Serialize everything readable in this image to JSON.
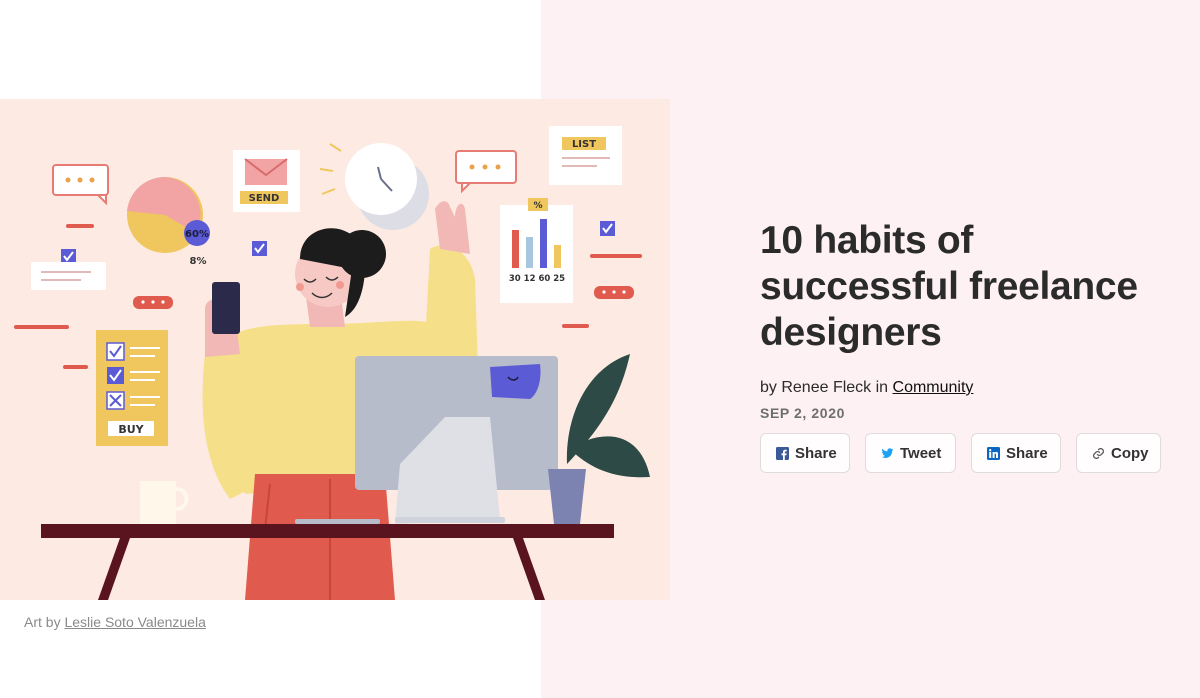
{
  "article": {
    "title": "10 habits of successful freelance designers",
    "byline_prefix": "by Renee Fleck in",
    "category": "Community",
    "date": "SEP 2, 2020"
  },
  "share_buttons": [
    {
      "label": "Share",
      "icon": "facebook-icon",
      "color": "#3b5998"
    },
    {
      "label": "Tweet",
      "icon": "twitter-icon",
      "color": "#1da1f2"
    },
    {
      "label": "Share",
      "icon": "linkedin-icon",
      "color": "#0a66c2"
    },
    {
      "label": "Copy",
      "icon": "link-icon",
      "color": "#555555"
    }
  ],
  "caption": {
    "prefix": "Art by",
    "artist": "Leslie Soto Valenzuela"
  },
  "illustration": {
    "send_label": "SEND",
    "list_label": "LIST",
    "buy_label": "BUY",
    "pie_percent": "60%",
    "small_percent": "8%",
    "chart_symbol": "%",
    "chart_numbers": "30 12 60 25"
  },
  "colors": {
    "panel_bg": "#fdf1f3",
    "hero_bg": "#fdebe3",
    "accent_red": "#e05a4e",
    "accent_yellow": "#f0c75e",
    "accent_blue": "#5b5bd6"
  }
}
